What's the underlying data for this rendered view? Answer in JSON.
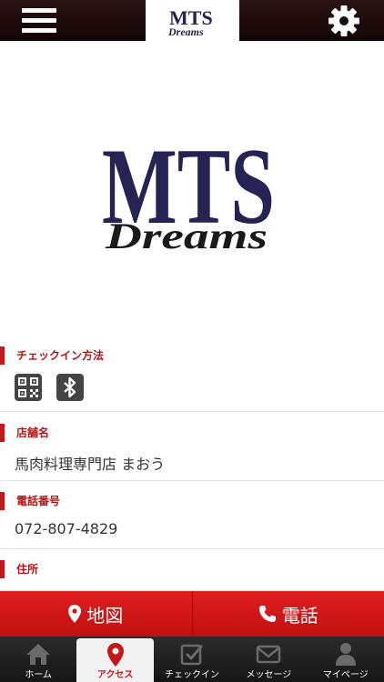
{
  "header": {
    "logo_top": "MTS",
    "logo_bottom": "Dreams",
    "menu_icon": "hamburger-icon",
    "settings_icon": "gear-icon"
  },
  "hero": {
    "logo_top": "MTS",
    "logo_bottom": "Dreams"
  },
  "sections": {
    "checkin": {
      "label": "チェックイン方法",
      "icons": [
        "qr-code-icon",
        "bluetooth-icon"
      ]
    },
    "store": {
      "label": "店舗名",
      "value": "馬肉料理専門店 まおう"
    },
    "phone": {
      "label": "電話番号",
      "value": "072-807-4829"
    },
    "address": {
      "label": "住所"
    }
  },
  "actions": {
    "map_label": "地図",
    "call_label": "電話"
  },
  "tabs": [
    {
      "label": "ホーム",
      "icon": "home-icon"
    },
    {
      "label": "アクセス",
      "icon": "map-pin-icon"
    },
    {
      "label": "チェックイン",
      "icon": "checkin-icon"
    },
    {
      "label": "メッセージ",
      "icon": "message-icon"
    },
    {
      "label": "マイページ",
      "icon": "user-icon"
    }
  ],
  "colors": {
    "accent": "#c41818",
    "navy": "#252354",
    "header_bg": "#1c0a0a"
  }
}
